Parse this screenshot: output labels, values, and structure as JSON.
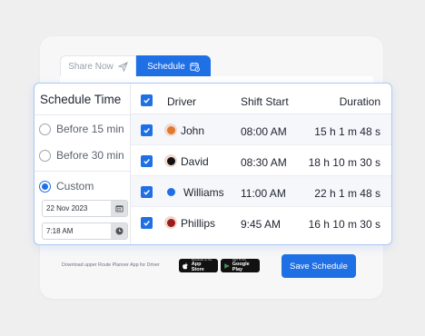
{
  "tabs": {
    "share_label": "Share Now",
    "schedule_label": "Schedule"
  },
  "schedule": {
    "title": "Schedule Time",
    "options": [
      "Before 15 min",
      "Before 30 min",
      "Custom"
    ],
    "selected": "Custom",
    "date_value": "22 Nov 2023",
    "time_value": "7:18 AM"
  },
  "table": {
    "headers": {
      "driver": "Driver",
      "shift_start": "Shift Start",
      "duration": "Duration"
    },
    "rows": [
      {
        "name": "John",
        "shift": "08:00 AM",
        "duration": "15 h 1 m 48 s",
        "color": "#e0792d",
        "checked": true
      },
      {
        "name": "David",
        "shift": "08:30 AM",
        "duration": "18 h 10 m 30 s",
        "color": "#111111",
        "checked": true
      },
      {
        "name": "Williams",
        "shift": "11:00 AM",
        "duration": "22 h 1 m 48 s",
        "color": "#1f6fe5",
        "checked": true
      },
      {
        "name": "Phillips",
        "shift": "9:45 AM",
        "duration": "16 h 10 m 30 s",
        "color": "#9b1c1c",
        "checked": true
      }
    ]
  },
  "footer": {
    "download_text": "Download upper Route Planner App for Driver",
    "app_store_small": "Download on the",
    "app_store_big": "App Store",
    "google_play_small": "GET IT ON",
    "google_play_big": "Google Play",
    "save_label": "Save Schedule"
  },
  "colors": {
    "accent": "#1f6fe5",
    "panel_border": "#a9c8f3"
  }
}
